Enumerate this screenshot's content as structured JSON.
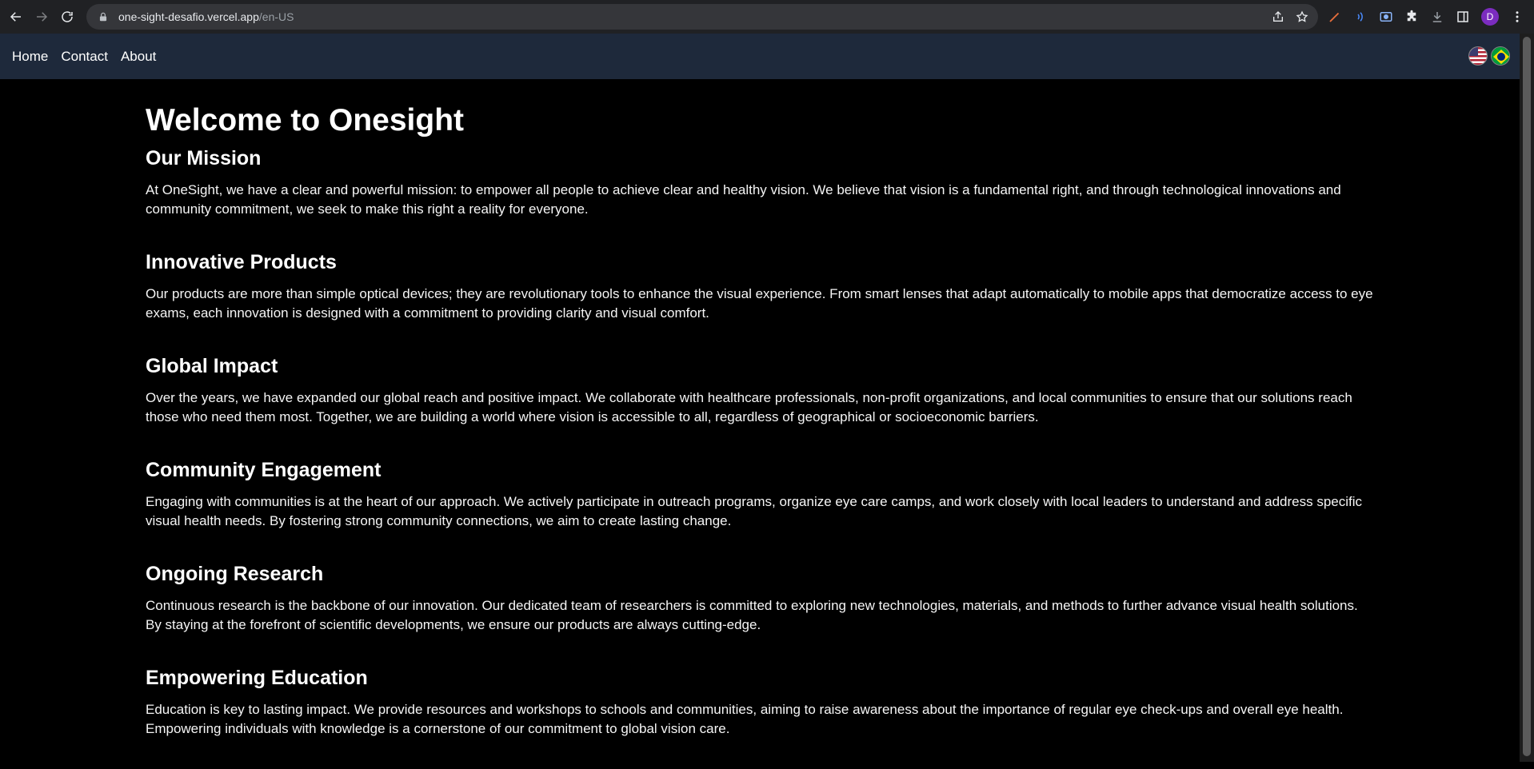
{
  "browser": {
    "url_host": "one-sight-desafio.vercel.app",
    "url_path": "/en-US",
    "profile_initial": "D"
  },
  "nav": {
    "links": [
      "Home",
      "Contact",
      "About"
    ]
  },
  "languages": [
    "en-US",
    "pt-BR"
  ],
  "main": {
    "title": "Welcome to Onesight",
    "sections": [
      {
        "heading": "Our Mission",
        "text": "At OneSight, we have a clear and powerful mission: to empower all people to achieve clear and healthy vision. We believe that vision is a fundamental right, and through technological innovations and community commitment, we seek to make this right a reality for everyone."
      },
      {
        "heading": "Innovative Products",
        "text": "Our products are more than simple optical devices; they are revolutionary tools to enhance the visual experience. From smart lenses that adapt automatically to mobile apps that democratize access to eye exams, each innovation is designed with a commitment to providing clarity and visual comfort."
      },
      {
        "heading": "Global Impact",
        "text": "Over the years, we have expanded our global reach and positive impact. We collaborate with healthcare professionals, non-profit organizations, and local communities to ensure that our solutions reach those who need them most. Together, we are building a world where vision is accessible to all, regardless of geographical or socioeconomic barriers."
      },
      {
        "heading": "Community Engagement",
        "text": "Engaging with communities is at the heart of our approach. We actively participate in outreach programs, organize eye care camps, and work closely with local leaders to understand and address specific visual health needs. By fostering strong community connections, we aim to create lasting change."
      },
      {
        "heading": "Ongoing Research",
        "text": "Continuous research is the backbone of our innovation. Our dedicated team of researchers is committed to exploring new technologies, materials, and methods to further advance visual health solutions. By staying at the forefront of scientific developments, we ensure our products are always cutting-edge."
      },
      {
        "heading": "Empowering Education",
        "text": "Education is key to lasting impact. We provide resources and workshops to schools and communities, aiming to raise awareness about the importance of regular eye check-ups and overall eye health. Empowering individuals with knowledge is a cornerstone of our commitment to global vision care."
      }
    ]
  },
  "colors": {
    "nav_bg": "#1e293b",
    "page_bg": "#000000",
    "chrome_bg": "#202124"
  }
}
